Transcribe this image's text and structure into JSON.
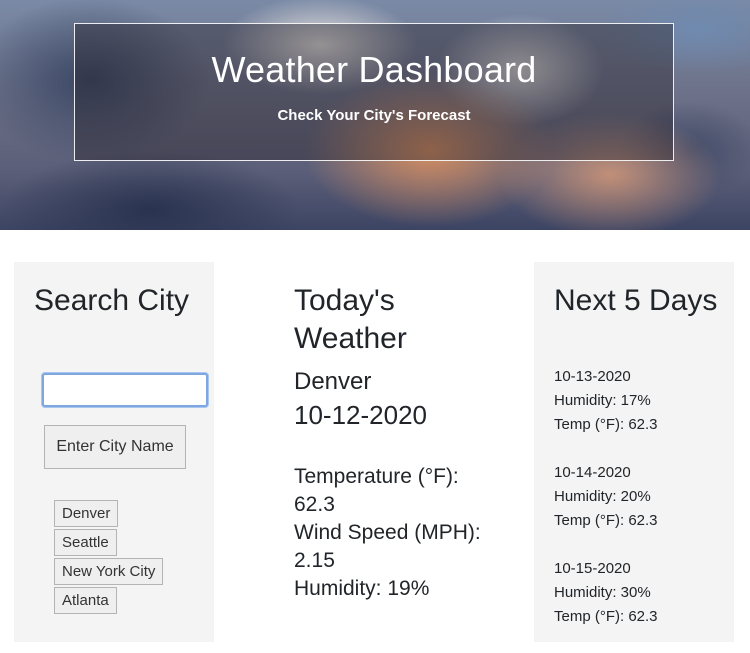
{
  "header": {
    "title": "Weather Dashboard",
    "subtitle": "Check Your City's Forecast"
  },
  "search": {
    "heading": "Search City",
    "input_value": "",
    "button_label": "Enter City Name",
    "history": [
      "Denver",
      "Seattle",
      "New York City",
      "Atlanta"
    ]
  },
  "today": {
    "heading": "Today's Weather",
    "city": "Denver",
    "date": "10-12-2020",
    "temperature": "Temperature (°F): 62.3",
    "wind": "Wind Speed (MPH): 2.15",
    "humidity": "Humidity: 19%"
  },
  "forecast": {
    "heading": "Next 5 Days",
    "days": [
      {
        "date": "10-13-2020",
        "humidity": "Humidity: 17%",
        "temp": "Temp (°F): 62.3"
      },
      {
        "date": "10-14-2020",
        "humidity": "Humidity: 20%",
        "temp": "Temp (°F): 62.3"
      },
      {
        "date": "10-15-2020",
        "humidity": "Humidity: 30%",
        "temp": "Temp (°F): 62.3"
      }
    ]
  },
  "colors": {
    "panel_bg": "#f4f4f4",
    "input_focus": "#7ea6e0",
    "button_bg": "#efefef"
  }
}
